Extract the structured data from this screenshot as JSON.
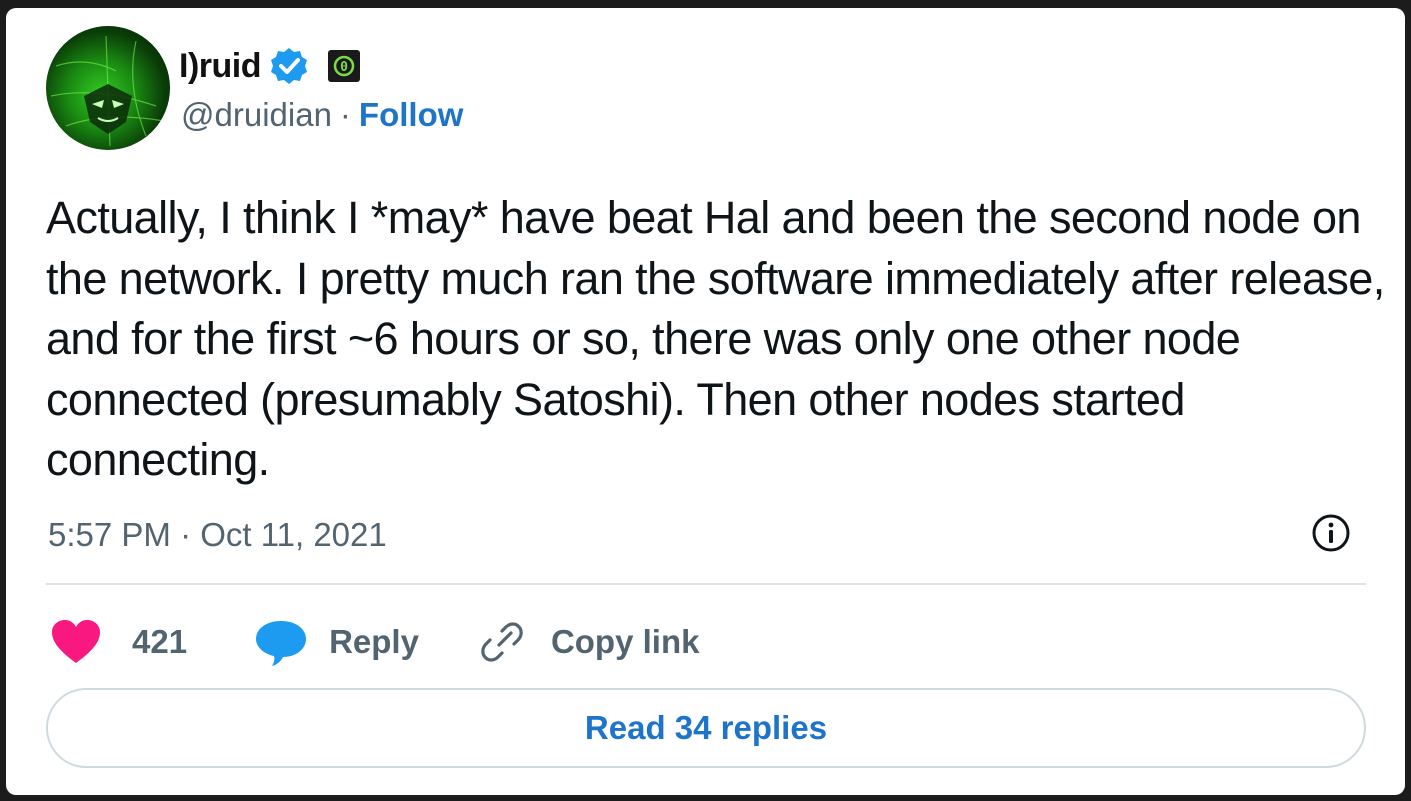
{
  "author": {
    "display_name": "I)ruid",
    "handle": "@druidian",
    "separator": "·",
    "follow_label": "Follow",
    "badge_glyph": "0",
    "verified_icon": "verified-badge-icon",
    "avatar": "avatar-image"
  },
  "tweet": {
    "text": "Actually, I think I *may* have beat Hal and been the second node on the network. I pretty much ran the software immediately after release, and for the first ~6 hours or so, there was only one other node connected (presumably Satoshi). Then other nodes started connecting.",
    "timestamp": "5:57 PM · Oct 11, 2021"
  },
  "actions": {
    "likes_count": "421",
    "reply_label": "Reply",
    "copy_link_label": "Copy link"
  },
  "footer": {
    "read_replies_label": "Read 34 replies"
  },
  "colors": {
    "accent_blue": "#1d74c9",
    "heart_pink": "#f91880",
    "reply_blue": "#1d9bf0",
    "secondary_text": "#536471"
  }
}
